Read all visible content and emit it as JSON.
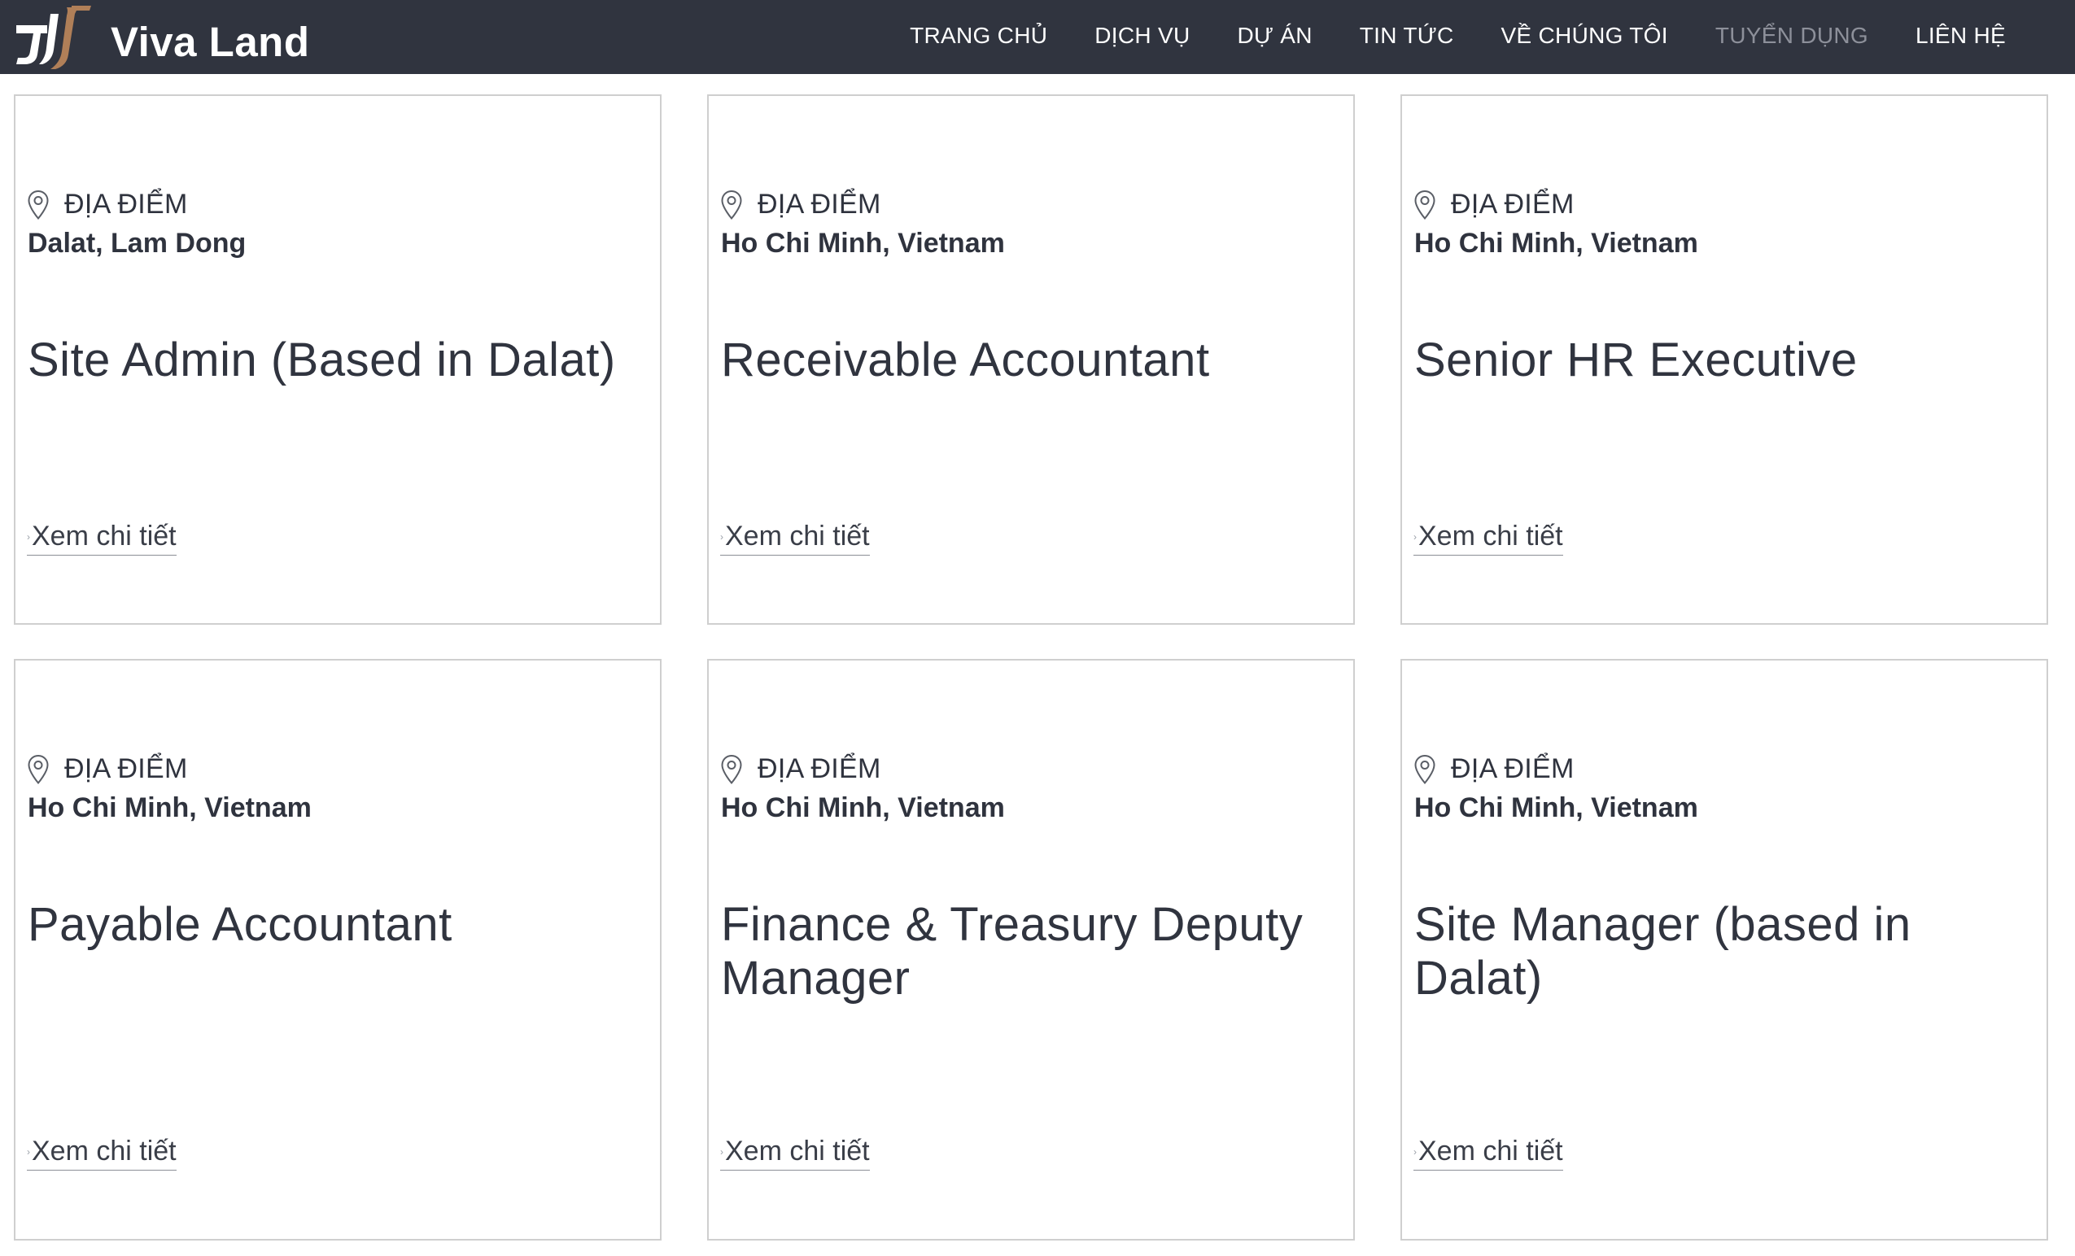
{
  "brand": {
    "name": "Viva Land",
    "logo_colors": {
      "dark": "#ffffff",
      "accent": "#b07f58"
    }
  },
  "nav": {
    "items": [
      {
        "label": "TRANG CHỦ",
        "active": false
      },
      {
        "label": "DỊCH VỤ",
        "active": false
      },
      {
        "label": "DỰ ÁN",
        "active": false
      },
      {
        "label": "TIN TỨC",
        "active": false
      },
      {
        "label": "VỀ CHÚNG TÔI",
        "active": false
      },
      {
        "label": "TUYỂN DỤNG",
        "active": true
      },
      {
        "label": "LIÊN HỆ",
        "active": false
      }
    ]
  },
  "jobs": [
    {
      "location_label": "ĐỊA ĐIỂM",
      "location": "Dalat, Lam Dong",
      "title": "Site Admin (Based in Dalat)",
      "link_label": "Xem chi tiết"
    },
    {
      "location_label": "ĐỊA ĐIỂM",
      "location": "Ho Chi Minh, Vietnam",
      "title": "Receivable Accountant",
      "link_label": "Xem chi tiết"
    },
    {
      "location_label": "ĐỊA ĐIỂM",
      "location": "Ho Chi Minh, Vietnam",
      "title": "Senior HR Executive",
      "link_label": "Xem chi tiết"
    },
    {
      "location_label": "ĐỊA ĐIỂM",
      "location": "Ho Chi Minh, Vietnam",
      "title": "Payable Accountant",
      "link_label": "Xem chi tiết"
    },
    {
      "location_label": "ĐỊA ĐIỂM",
      "location": "Ho Chi Minh, Vietnam",
      "title": "Finance & Treasury Deputy Manager",
      "link_label": "Xem chi tiết"
    },
    {
      "location_label": "ĐỊA ĐIỂM",
      "location": "Ho Chi Minh, Vietnam",
      "title": "Site Manager (based in Dalat)",
      "link_label": "Xem chi tiết"
    }
  ],
  "icons": {
    "location": "map-pin-icon",
    "link_arrow": "arrow-right-icon"
  },
  "colors": {
    "header_bg": "#30343f",
    "nav_text": "#ffffff",
    "nav_active": "#8d909a",
    "card_border": "#cfcfcf",
    "text": "#30343f"
  }
}
